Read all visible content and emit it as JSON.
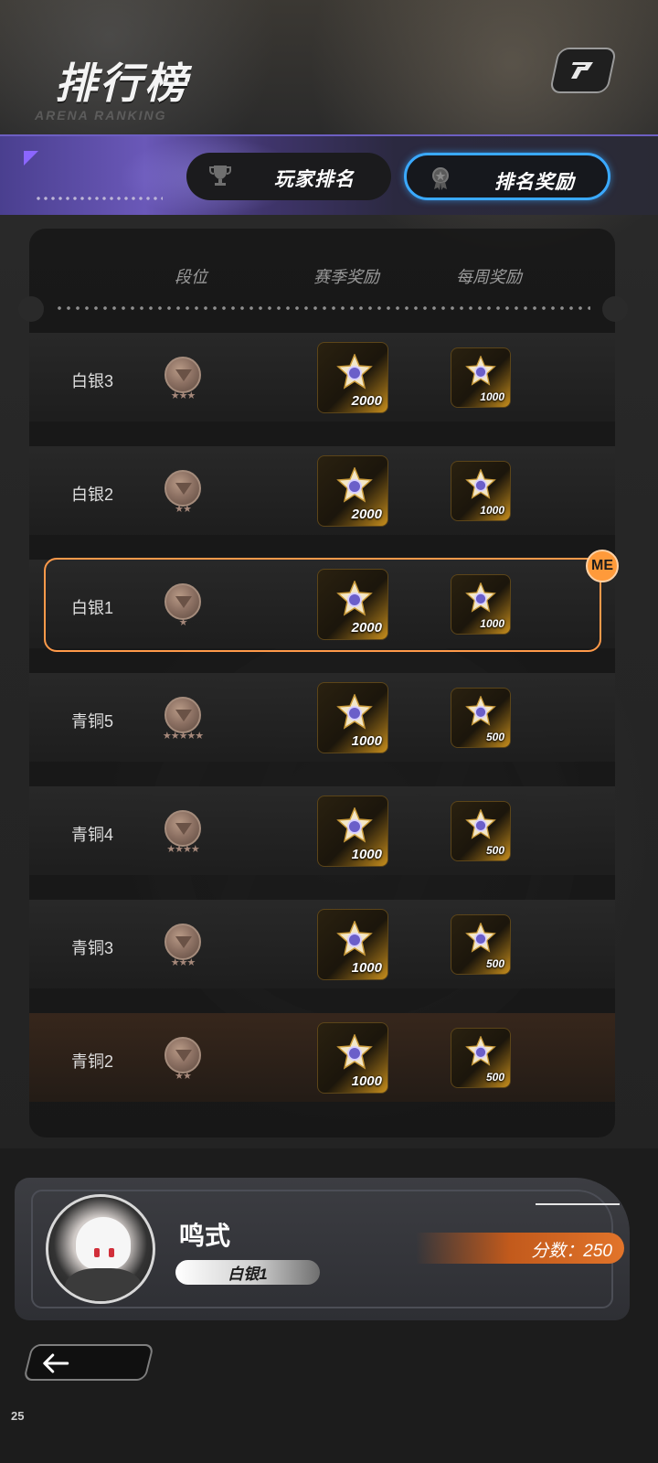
{
  "header": {
    "title": "排行榜",
    "subtitle": "ARENA RANKING"
  },
  "tabs": [
    {
      "label": "玩家排名",
      "icon": "trophy-icon",
      "active": false
    },
    {
      "label": "排名奖励",
      "icon": "medal-icon",
      "active": true
    }
  ],
  "table": {
    "columns": [
      "段位",
      "赛季奖励",
      "每周奖励"
    ],
    "rows": [
      {
        "tier": "白银3",
        "stars": 3,
        "season_reward": "2000",
        "weekly_reward": "1000"
      },
      {
        "tier": "白银2",
        "stars": 2,
        "season_reward": "2000",
        "weekly_reward": "1000"
      },
      {
        "tier": "白银1",
        "stars": 1,
        "season_reward": "2000",
        "weekly_reward": "1000",
        "current": true
      },
      {
        "tier": "青铜5",
        "stars": 5,
        "season_reward": "1000",
        "weekly_reward": "500"
      },
      {
        "tier": "青铜4",
        "stars": 4,
        "season_reward": "1000",
        "weekly_reward": "500"
      },
      {
        "tier": "青铜3",
        "stars": 3,
        "season_reward": "1000",
        "weekly_reward": "500"
      },
      {
        "tier": "青铜2",
        "stars": 2,
        "season_reward": "1000",
        "weekly_reward": "500"
      }
    ],
    "me_badge": "ME"
  },
  "player": {
    "name": "鸣式",
    "rank": "白银1",
    "score_label": "分数：250"
  },
  "footer": {
    "back_icon": "arrow-left-icon",
    "fps": "25"
  },
  "colors": {
    "accent_blue": "#3aa9ff",
    "highlight_orange": "#ff9a4a",
    "tab_purple": "#6a58b8"
  }
}
